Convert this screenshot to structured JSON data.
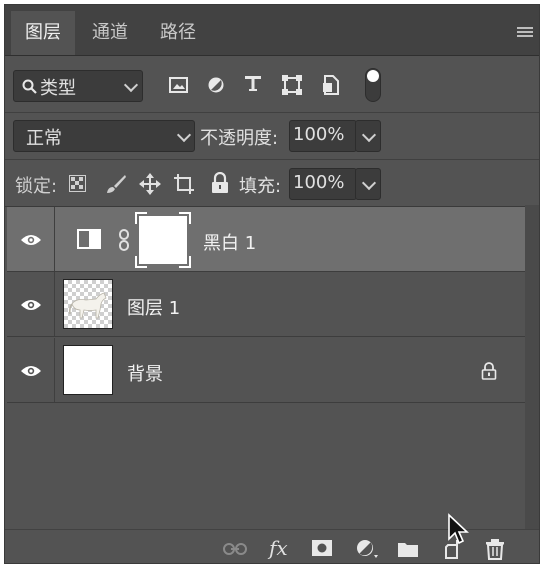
{
  "tabs": [
    {
      "label": "图层",
      "active": true
    },
    {
      "label": "通道",
      "active": false
    },
    {
      "label": "路径",
      "active": false
    }
  ],
  "filter": {
    "kind_label": "类型",
    "icons": [
      "image-filter-icon",
      "adjustment-filter-icon",
      "type-filter-icon",
      "shape-filter-icon",
      "smart-object-filter-icon",
      "filter-toggle-switch"
    ]
  },
  "blend": {
    "mode": "正常",
    "opacity_label": "不透明度:",
    "opacity_value": "100%"
  },
  "lock": {
    "label": "锁定:",
    "icons": [
      "lock-transparent-pixels-icon",
      "lock-image-pixels-icon",
      "lock-position-icon",
      "lock-artboard-icon",
      "lock-all-icon"
    ],
    "fill_label": "填充:",
    "fill_value": "100%"
  },
  "layers": [
    {
      "name": "黑白 1",
      "type": "adjustment",
      "visible": true,
      "selected": true
    },
    {
      "name": "图层 1",
      "type": "pixel",
      "visible": true,
      "selected": false
    },
    {
      "name": "背景",
      "type": "background",
      "visible": true,
      "selected": false,
      "locked": true
    }
  ],
  "bottom_icons": [
    "link-layers-icon",
    "fx-icon",
    "add-mask-icon",
    "new-adjustment-icon",
    "new-group-icon",
    "new-layer-icon",
    "delete-layer-icon"
  ],
  "bottom_fx_label": "fx",
  "colors": {
    "panel_bg": "#535353",
    "tab_bar_bg": "#424242",
    "selected_layer_bg": "#6f6f6f",
    "field_bg": "#3c3c3c"
  }
}
